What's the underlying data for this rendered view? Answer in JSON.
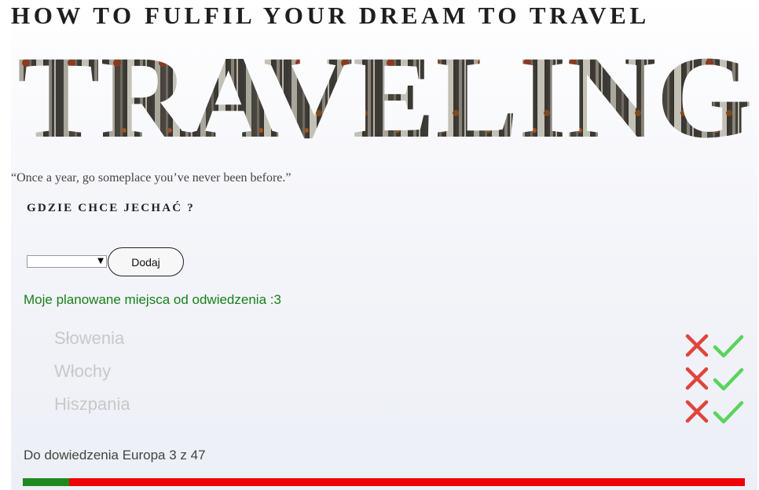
{
  "header": {
    "subtitle": "HOW TO FULFIL YOUR DREAM TO TRAVEL",
    "hero_title": "TRAVELING"
  },
  "quote": "“Once a year, go someplace you’ve never been before.”",
  "question": "GDZIE CHCE JECHAĆ ?",
  "form": {
    "select_value": "",
    "add_label": "Dodaj"
  },
  "planned_label": "Moje planowane miejsca od odwiedzenia :3",
  "places": [
    {
      "name": "Słowenia",
      "remove_icon": "x-icon",
      "done_icon": "check-icon"
    },
    {
      "name": "Włochy",
      "remove_icon": "x-icon",
      "done_icon": "check-icon"
    },
    {
      "name": "Hiszpania",
      "remove_icon": "x-icon",
      "done_icon": "check-icon"
    }
  ],
  "summary": "Do dowiedzenia Europa 3 z 47",
  "progress": {
    "done": 3,
    "total": 47
  },
  "colors": {
    "accent_green": "#1a7f1a",
    "progress_done": "#1e8a1e",
    "progress_remaining": "#ee0000",
    "remove_icon": "#e0443c",
    "check_icon": "#5bd35b",
    "muted_text": "#c8c8c8"
  }
}
